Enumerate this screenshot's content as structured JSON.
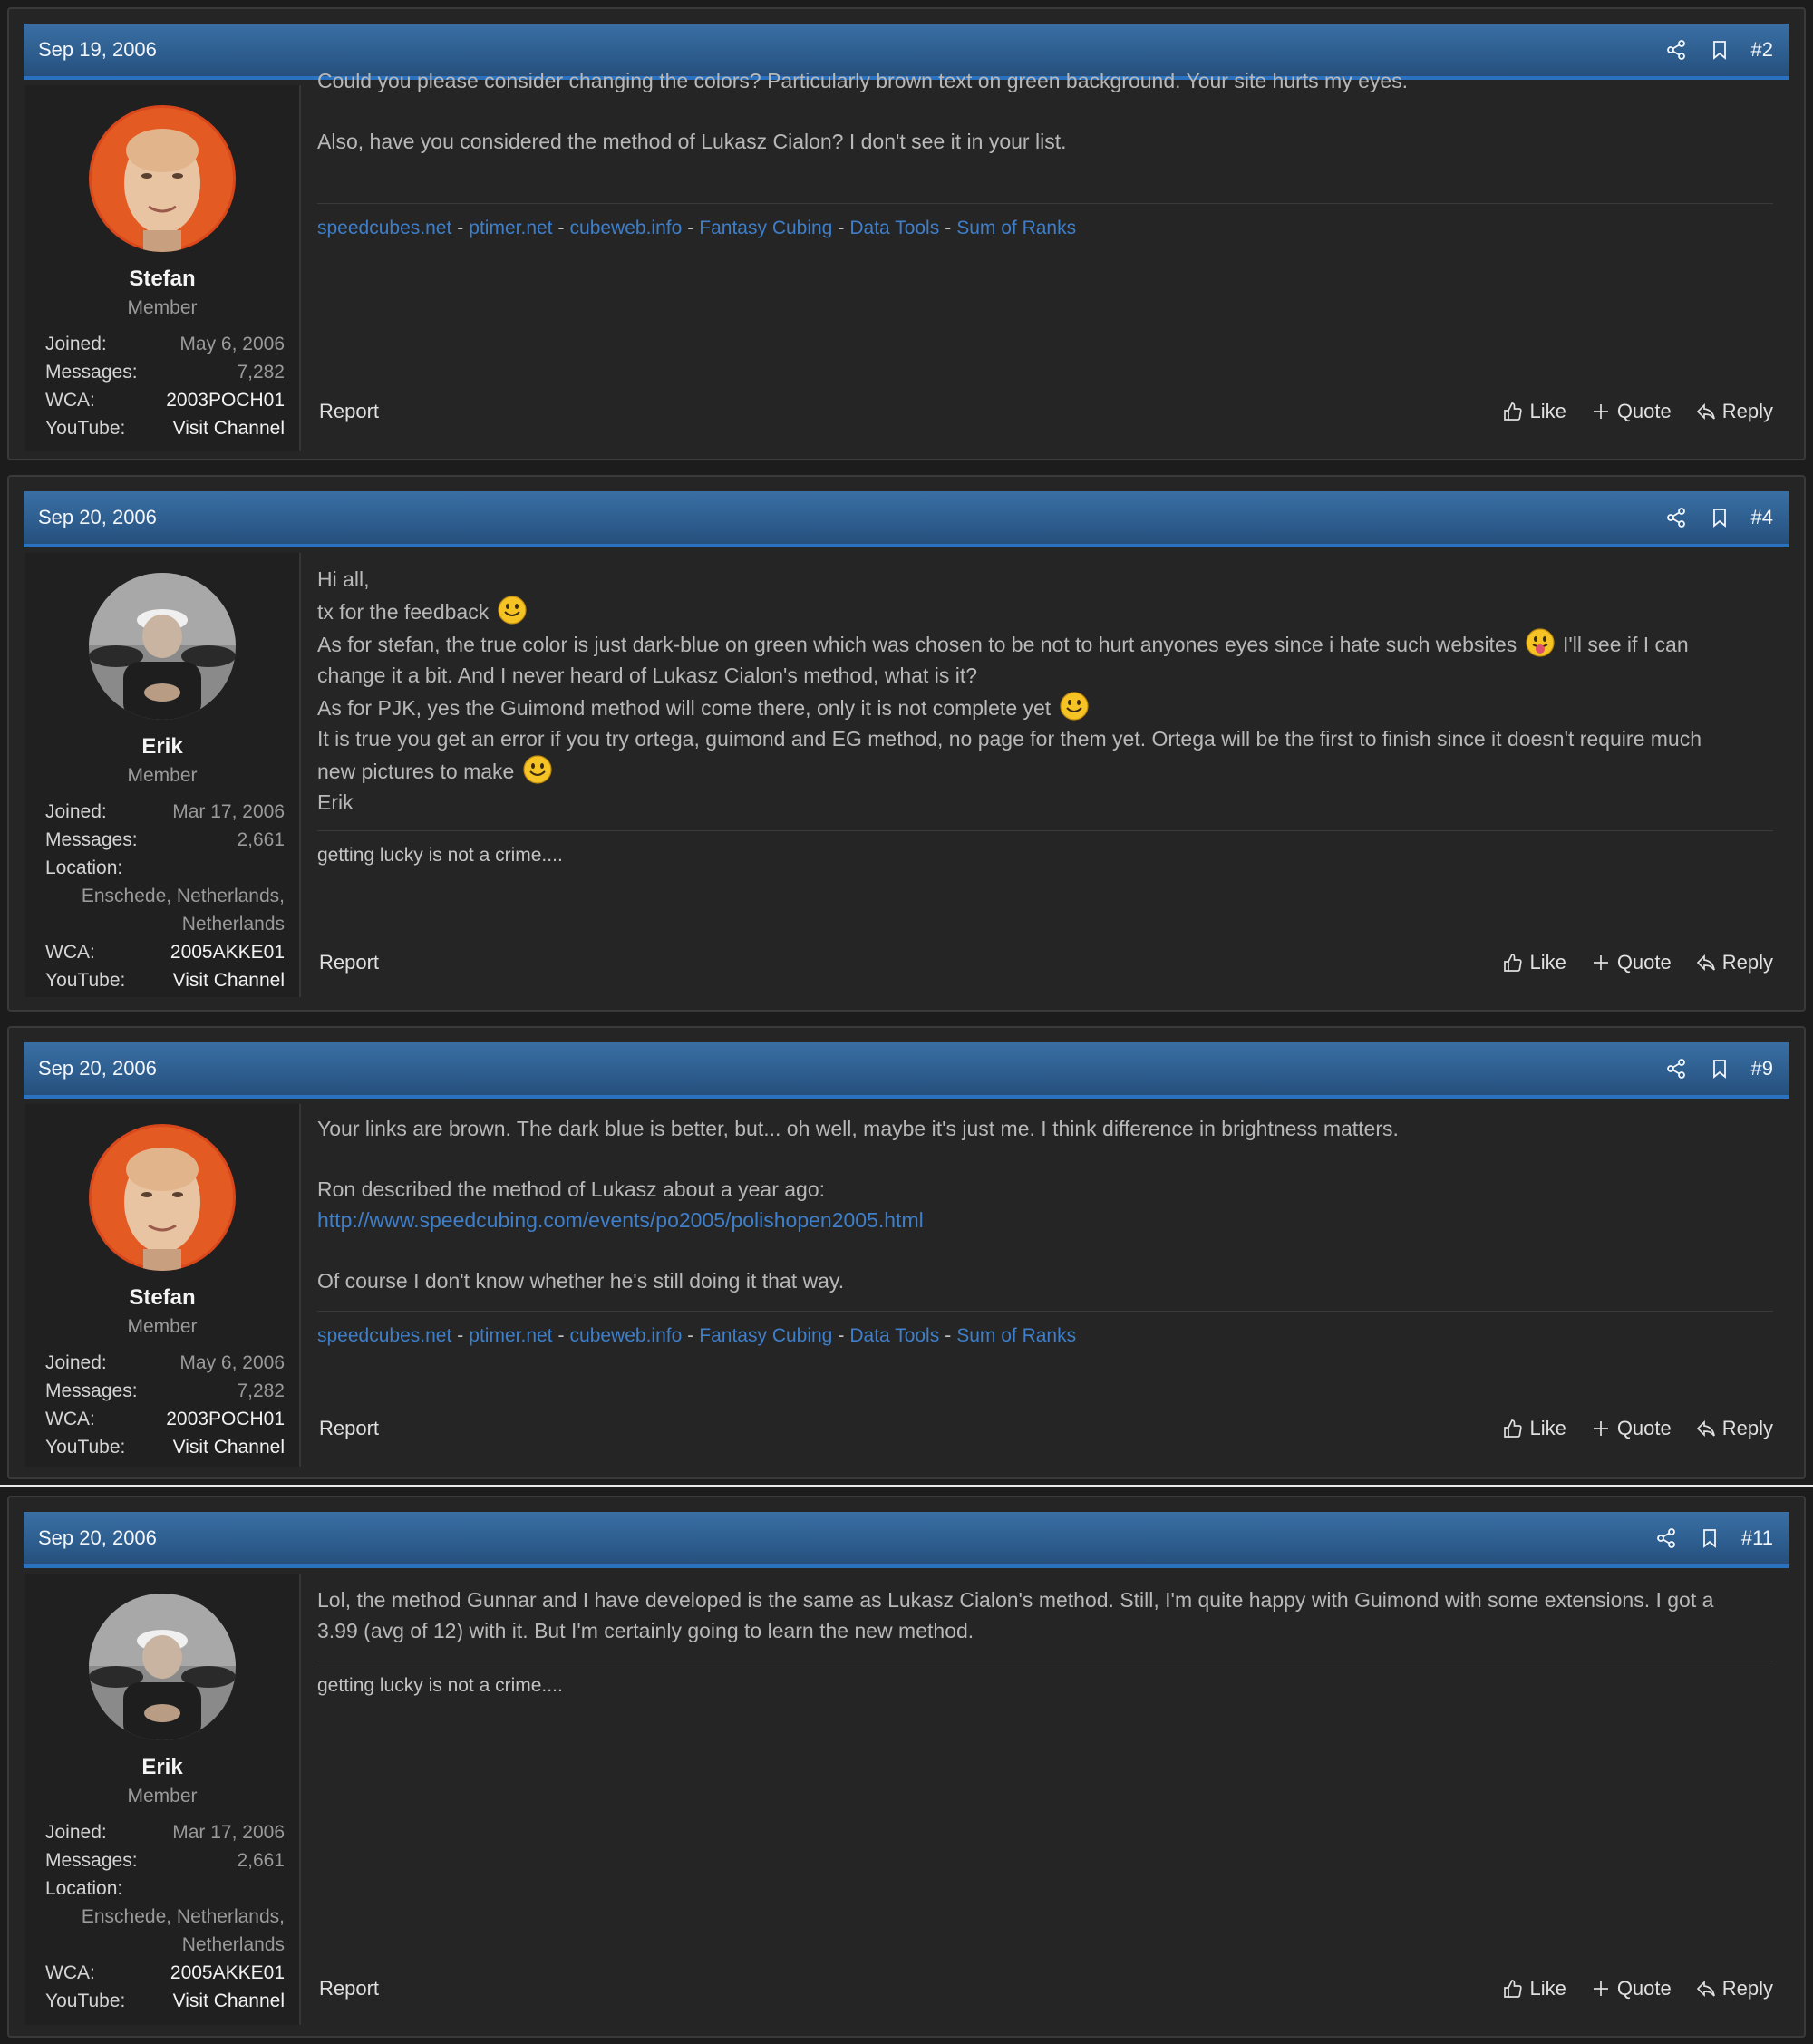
{
  "posts": [
    {
      "date": "Sep 19, 2006",
      "number": "#2",
      "user": {
        "name": "Stefan",
        "title": "Member",
        "avatar": "stefan",
        "stats": [
          {
            "k": "Joined:",
            "v": "May 6, 2006"
          },
          {
            "k": "Messages:",
            "v": "7,282"
          },
          {
            "k": "WCA:",
            "v": "2003POCH01",
            "light": true
          },
          {
            "k": "YouTube:",
            "v": "Visit Channel",
            "light": true
          }
        ]
      },
      "body": {
        "line1": "Could you please consider changing the colors? Particularly brown text on green background. Your site hurts my eyes.",
        "line2": "Also, have you considered the method of Lukasz Cialon? I don't see it in your list."
      },
      "signature_links": [
        "speedcubes.net",
        "ptimer.net",
        "cubeweb.info",
        "Fantasy Cubing",
        "Data Tools",
        "Sum of Ranks"
      ],
      "signature_sep": "-"
    },
    {
      "date": "Sep 20, 2006",
      "number": "#4",
      "user": {
        "name": "Erik",
        "title": "Member",
        "avatar": "erik",
        "stats": [
          {
            "k": "Joined:",
            "v": "Mar 17, 2006"
          },
          {
            "k": "Messages:",
            "v": "2,661"
          }
        ],
        "location_label": "Location:",
        "location_value_1": "Enschede, Netherlands,",
        "location_value_2": "Netherlands",
        "stats2": [
          {
            "k": "WCA:",
            "v": "2005AKKE01",
            "light": true
          },
          {
            "k": "YouTube:",
            "v": "Visit Channel",
            "light": true
          }
        ]
      },
      "body": {
        "line1": "Hi all,",
        "line2": "tx for the feedback",
        "line3a": "As for stefan, the true color is just dark-blue on green which was chosen to be not to hurt anyones eyes since i hate such websites",
        "line3b": "I'll see if I can",
        "line3c": "change it a bit. And I never heard of Lukasz Cialon's method, what is it?",
        "line4": "As for PJK, yes the Guimond method will come there, only it is not complete yet",
        "line5": "It is true you get an error if you try ortega, guimond and EG method, no page for them yet. Ortega will be the first to finish since it doesn't require much",
        "line6": "new pictures to make",
        "line7": "Erik"
      },
      "signature": "getting lucky is not a crime...."
    },
    {
      "date": "Sep 20, 2006",
      "number": "#9",
      "user": {
        "name": "Stefan",
        "title": "Member",
        "avatar": "stefan",
        "stats": [
          {
            "k": "Joined:",
            "v": "May 6, 2006"
          },
          {
            "k": "Messages:",
            "v": "7,282"
          },
          {
            "k": "WCA:",
            "v": "2003POCH01",
            "light": true
          },
          {
            "k": "YouTube:",
            "v": "Visit Channel",
            "light": true
          }
        ]
      },
      "body": {
        "line1": "Your links are brown. The dark blue is better, but... oh well, maybe it's just me. I think difference in brightness matters.",
        "line2": "Ron described the method of Lukasz about a year ago:",
        "link": "http://www.speedcubing.com/events/po2005/polishopen2005.html",
        "line3": "Of course I don't know whether he's still doing it that way."
      },
      "signature_links": [
        "speedcubes.net",
        "ptimer.net",
        "cubeweb.info",
        "Fantasy Cubing",
        "Data Tools",
        "Sum of Ranks"
      ],
      "signature_sep": "-"
    },
    {
      "date": "Sep 20, 2006",
      "number": "#11",
      "user": {
        "name": "Erik",
        "title": "Member",
        "avatar": "erik",
        "stats": [
          {
            "k": "Joined:",
            "v": "Mar 17, 2006"
          },
          {
            "k": "Messages:",
            "v": "2,661"
          }
        ],
        "location_label": "Location:",
        "location_value_1": "Enschede, Netherlands,",
        "location_value_2": "Netherlands",
        "stats2": [
          {
            "k": "WCA:",
            "v": "2005AKKE01",
            "light": true
          },
          {
            "k": "YouTube:",
            "v": "Visit Channel",
            "light": true
          }
        ]
      },
      "body": {
        "line1": "Lol, the method Gunnar and I have developed is the same as Lukasz Cialon's method. Still, I'm quite happy with Guimond with some extensions. I got a",
        "line2": "3.99 (avg of 12) with it. But I'm certainly going to learn the new method."
      },
      "signature": "getting lucky is not a crime...."
    }
  ],
  "actions": {
    "report": "Report",
    "like": "Like",
    "quote": "Quote",
    "reply": "Reply"
  },
  "icons": {
    "share": "share-icon",
    "bookmark": "bookmark-icon",
    "like": "thumbs-up-icon",
    "quote": "plus-icon",
    "reply": "reply-icon",
    "smile": "smile-emoji",
    "tongue": "tongue-emoji"
  },
  "colors": {
    "header_blue": "#2d5d8e",
    "header_accent": "#2a72c0",
    "link": "#3f7fc9",
    "background": "#252525"
  }
}
